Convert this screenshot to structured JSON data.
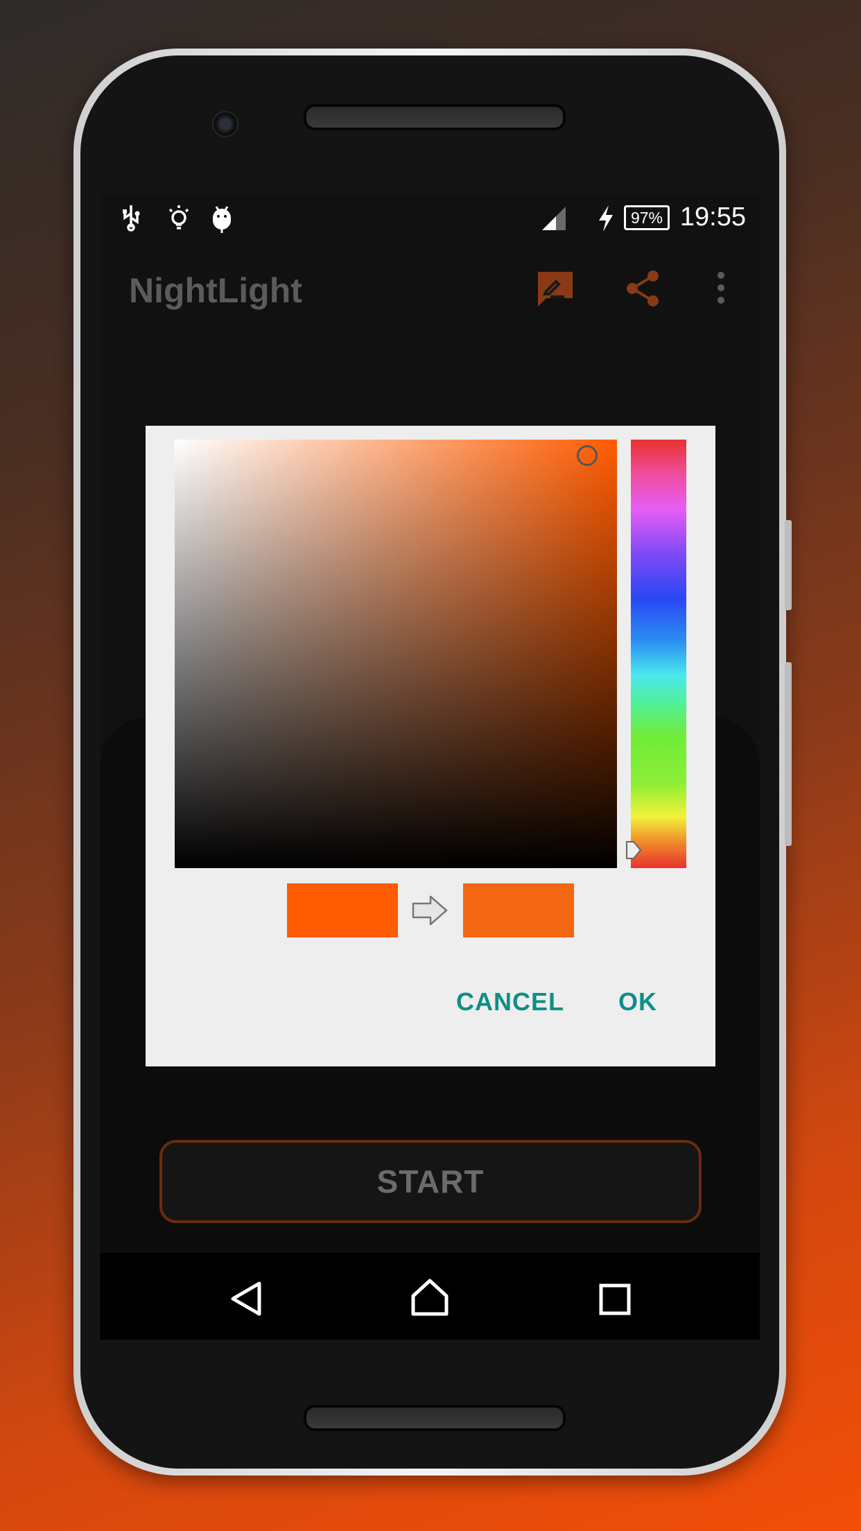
{
  "status_bar": {
    "left_icons": [
      "usb-icon",
      "lightbulb-icon",
      "android-icon"
    ],
    "right_icons": [
      "signal-icon",
      "charging-icon"
    ],
    "battery": "97%",
    "time": "19:55"
  },
  "app_bar": {
    "title": "NightLight",
    "actions": [
      "feedback-icon",
      "share-icon",
      "more-vert-icon"
    ],
    "accent_color": "#8a3a14"
  },
  "color_picker": {
    "old_color": "#ff5b00",
    "new_color": "#f36612",
    "hue_gradient": [
      "#e8322e",
      "#e75df4",
      "#2a47f4",
      "#4be8ef",
      "#70ec3a",
      "#f2f23a",
      "#e8322e"
    ],
    "cancel_label": "CANCEL",
    "ok_label": "OK",
    "button_color": "#0d8f86"
  },
  "main": {
    "start_label": "START"
  },
  "nav_bar": {
    "buttons": [
      "back-icon",
      "home-icon",
      "recents-icon"
    ]
  }
}
